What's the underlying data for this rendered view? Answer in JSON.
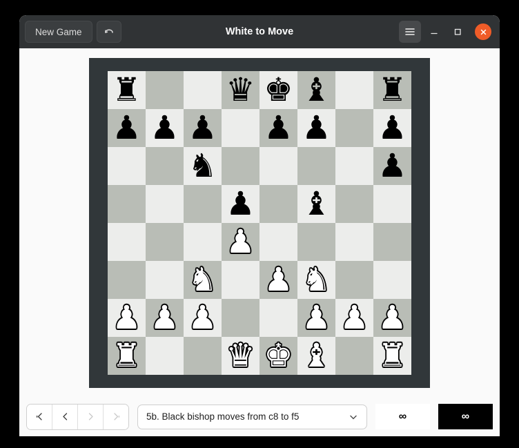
{
  "window": {
    "title": "White to Move",
    "titlebar": {
      "new_game_label": "New Game",
      "undo_icon": "undo-arrow-icon",
      "menu_icon": "hamburger-menu-icon",
      "minimize_icon": "minimize-icon",
      "maximize_icon": "maximize-icon",
      "close_icon": "close-icon",
      "close_color": "#ef5c28",
      "titlebar_color": "#303335"
    }
  },
  "board": {
    "frame_color": "#31373a",
    "light_square_color": "#ecedeb",
    "dark_square_color": "#b9bdb6",
    "orientation": "white-bottom",
    "fen": "r2qkb1r/ppp1pp1p/2n4p/3p1b2/3P4/2N1PN2/PPP2PPP/R2QKB1R",
    "ranks": [
      {
        "rank": 8,
        "squares": [
          {
            "file": "a",
            "piece": "black-rook",
            "glyph": "♜",
            "color": "black"
          },
          {
            "file": "b",
            "piece": null,
            "glyph": "",
            "color": null
          },
          {
            "file": "c",
            "piece": null,
            "glyph": "",
            "color": null
          },
          {
            "file": "d",
            "piece": "black-queen",
            "glyph": "♛",
            "color": "black"
          },
          {
            "file": "e",
            "piece": "black-king",
            "glyph": "♚",
            "color": "black"
          },
          {
            "file": "f",
            "piece": "black-bishop",
            "glyph": "♝",
            "color": "black"
          },
          {
            "file": "g",
            "piece": null,
            "glyph": "",
            "color": null
          },
          {
            "file": "h",
            "piece": "black-rook",
            "glyph": "♜",
            "color": "black"
          }
        ]
      },
      {
        "rank": 7,
        "squares": [
          {
            "file": "a",
            "piece": "black-pawn",
            "glyph": "♟",
            "color": "black"
          },
          {
            "file": "b",
            "piece": "black-pawn",
            "glyph": "♟",
            "color": "black"
          },
          {
            "file": "c",
            "piece": "black-pawn",
            "glyph": "♟",
            "color": "black"
          },
          {
            "file": "d",
            "piece": null,
            "glyph": "",
            "color": null
          },
          {
            "file": "e",
            "piece": "black-pawn",
            "glyph": "♟",
            "color": "black"
          },
          {
            "file": "f",
            "piece": "black-pawn",
            "glyph": "♟",
            "color": "black"
          },
          {
            "file": "g",
            "piece": null,
            "glyph": "",
            "color": null
          },
          {
            "file": "h",
            "piece": "black-pawn",
            "glyph": "♟",
            "color": "black"
          }
        ]
      },
      {
        "rank": 6,
        "squares": [
          {
            "file": "a",
            "piece": null,
            "glyph": "",
            "color": null
          },
          {
            "file": "b",
            "piece": null,
            "glyph": "",
            "color": null
          },
          {
            "file": "c",
            "piece": "black-knight",
            "glyph": "♞",
            "color": "black"
          },
          {
            "file": "d",
            "piece": null,
            "glyph": "",
            "color": null
          },
          {
            "file": "e",
            "piece": null,
            "glyph": "",
            "color": null
          },
          {
            "file": "f",
            "piece": null,
            "glyph": "",
            "color": null
          },
          {
            "file": "g",
            "piece": null,
            "glyph": "",
            "color": null
          },
          {
            "file": "h",
            "piece": "black-pawn",
            "glyph": "♟",
            "color": "black"
          }
        ]
      },
      {
        "rank": 5,
        "squares": [
          {
            "file": "a",
            "piece": null,
            "glyph": "",
            "color": null
          },
          {
            "file": "b",
            "piece": null,
            "glyph": "",
            "color": null
          },
          {
            "file": "c",
            "piece": null,
            "glyph": "",
            "color": null
          },
          {
            "file": "d",
            "piece": "black-pawn",
            "glyph": "♟",
            "color": "black"
          },
          {
            "file": "e",
            "piece": null,
            "glyph": "",
            "color": null
          },
          {
            "file": "f",
            "piece": "black-bishop",
            "glyph": "♝",
            "color": "black"
          },
          {
            "file": "g",
            "piece": null,
            "glyph": "",
            "color": null
          },
          {
            "file": "h",
            "piece": null,
            "glyph": "",
            "color": null
          }
        ]
      },
      {
        "rank": 4,
        "squares": [
          {
            "file": "a",
            "piece": null,
            "glyph": "",
            "color": null
          },
          {
            "file": "b",
            "piece": null,
            "glyph": "",
            "color": null
          },
          {
            "file": "c",
            "piece": null,
            "glyph": "",
            "color": null
          },
          {
            "file": "d",
            "piece": "white-pawn",
            "glyph": "♟",
            "color": "white"
          },
          {
            "file": "e",
            "piece": null,
            "glyph": "",
            "color": null
          },
          {
            "file": "f",
            "piece": null,
            "glyph": "",
            "color": null
          },
          {
            "file": "g",
            "piece": null,
            "glyph": "",
            "color": null
          },
          {
            "file": "h",
            "piece": null,
            "glyph": "",
            "color": null
          }
        ]
      },
      {
        "rank": 3,
        "squares": [
          {
            "file": "a",
            "piece": null,
            "glyph": "",
            "color": null
          },
          {
            "file": "b",
            "piece": null,
            "glyph": "",
            "color": null
          },
          {
            "file": "c",
            "piece": "white-knight",
            "glyph": "♞",
            "color": "white"
          },
          {
            "file": "d",
            "piece": null,
            "glyph": "",
            "color": null
          },
          {
            "file": "e",
            "piece": "white-pawn",
            "glyph": "♟",
            "color": "white"
          },
          {
            "file": "f",
            "piece": "white-knight",
            "glyph": "♞",
            "color": "white"
          },
          {
            "file": "g",
            "piece": null,
            "glyph": "",
            "color": null
          },
          {
            "file": "h",
            "piece": null,
            "glyph": "",
            "color": null
          }
        ]
      },
      {
        "rank": 2,
        "squares": [
          {
            "file": "a",
            "piece": "white-pawn",
            "glyph": "♟",
            "color": "white"
          },
          {
            "file": "b",
            "piece": "white-pawn",
            "glyph": "♟",
            "color": "white"
          },
          {
            "file": "c",
            "piece": "white-pawn",
            "glyph": "♟",
            "color": "white"
          },
          {
            "file": "d",
            "piece": null,
            "glyph": "",
            "color": null
          },
          {
            "file": "e",
            "piece": null,
            "glyph": "",
            "color": null
          },
          {
            "file": "f",
            "piece": "white-pawn",
            "glyph": "♟",
            "color": "white"
          },
          {
            "file": "g",
            "piece": "white-pawn",
            "glyph": "♟",
            "color": "white"
          },
          {
            "file": "h",
            "piece": "white-pawn",
            "glyph": "♟",
            "color": "white"
          }
        ]
      },
      {
        "rank": 1,
        "squares": [
          {
            "file": "a",
            "piece": "white-rook",
            "glyph": "♜",
            "color": "white"
          },
          {
            "file": "b",
            "piece": null,
            "glyph": "",
            "color": null
          },
          {
            "file": "c",
            "piece": null,
            "glyph": "",
            "color": null
          },
          {
            "file": "d",
            "piece": "white-queen",
            "glyph": "♛",
            "color": "white"
          },
          {
            "file": "e",
            "piece": "white-king",
            "glyph": "♚",
            "color": "white"
          },
          {
            "file": "f",
            "piece": "white-bishop",
            "glyph": "♝",
            "color": "white"
          },
          {
            "file": "g",
            "piece": null,
            "glyph": "",
            "color": null
          },
          {
            "file": "h",
            "piece": "white-rook",
            "glyph": "♜",
            "color": "white"
          }
        ]
      }
    ]
  },
  "bottombar": {
    "nav": [
      {
        "name": "first-move-button",
        "icon": "skip-to-start-icon",
        "disabled": false
      },
      {
        "name": "previous-move-button",
        "icon": "step-back-icon",
        "disabled": false
      },
      {
        "name": "next-move-button",
        "icon": "step-forward-icon",
        "disabled": true
      },
      {
        "name": "last-move-button",
        "icon": "skip-to-end-icon",
        "disabled": true
      }
    ],
    "move_select": {
      "value": "5b. Black bishop moves from c8 to f5",
      "chevron_icon": "chevron-down-icon"
    },
    "white_clock": "∞",
    "black_clock": "∞"
  }
}
